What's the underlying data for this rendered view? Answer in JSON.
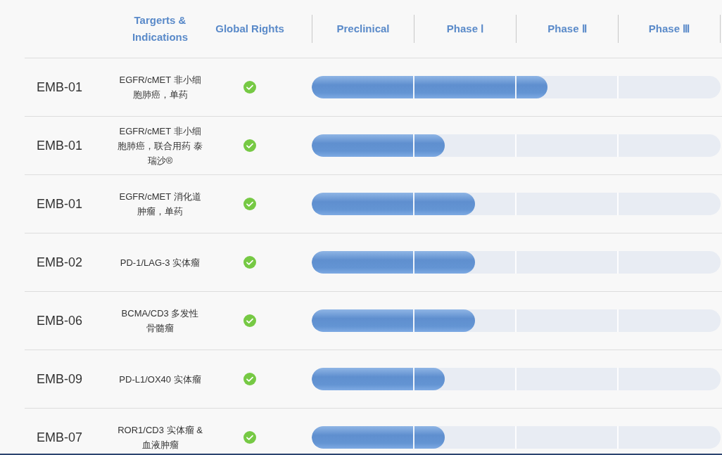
{
  "header": {
    "column_1": "Targerts & Indications",
    "column_2": "Global Rights",
    "phases": [
      "Preclinical",
      "Phase Ⅰ",
      "Phase Ⅱ",
      "Phase Ⅲ"
    ]
  },
  "rows": [
    {
      "drug": "EMB-01",
      "indication": "EGFR/cMET 非小细胞肺癌，单药",
      "global_rights": true,
      "level": 0.577
    },
    {
      "drug": "EMB-01",
      "indication": "EGFR/cMET 非小细胞肺癌，联合用药 泰瑞沙®",
      "global_rights": true,
      "level": 0.325
    },
    {
      "drug": "EMB-01",
      "indication": "EGFR/cMET 消化道肿瘤，单药",
      "global_rights": true,
      "level": 0.4
    },
    {
      "drug": "EMB-02",
      "indication": "PD-1/LAG-3 实体瘤",
      "global_rights": true,
      "level": 0.4
    },
    {
      "drug": "EMB-06",
      "indication": "BCMA/CD3 多发性骨髓瘤",
      "global_rights": true,
      "level": 0.4
    },
    {
      "drug": "EMB-09",
      "indication": "PD-L1/OX40 实体瘤",
      "global_rights": true,
      "level": 0.325
    },
    {
      "drug": "EMB-07",
      "indication": "ROR1/CD3 实体瘤 & 血液肿瘤",
      "global_rights": true,
      "level": 0.325
    }
  ]
}
